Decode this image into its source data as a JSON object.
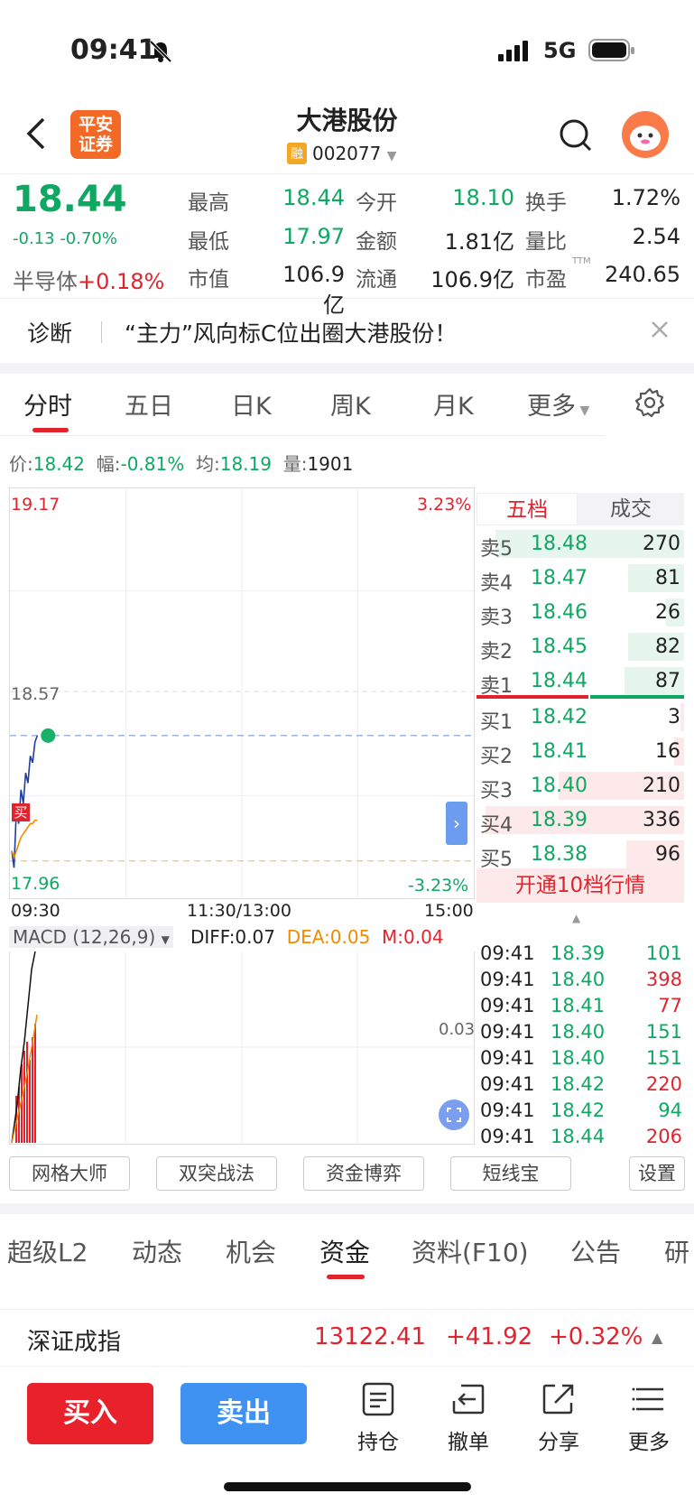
{
  "status": {
    "time": "09:41",
    "network": "5G"
  },
  "header": {
    "logo_line1": "平安",
    "logo_line2": "证券",
    "stock_name": "大港股份",
    "margin_badge": "融",
    "stock_code": "002077"
  },
  "quote": {
    "price": "18.44",
    "change": "-0.13",
    "change_pct": "-0.70%",
    "sector_name": "半导体",
    "sector_change": "+0.18%",
    "fields": [
      {
        "label": "最高",
        "value": "18.44",
        "color": "#0fa863"
      },
      {
        "label": "今开",
        "value": "18.10",
        "color": "#0fa863"
      },
      {
        "label": "换手",
        "value": "1.72%",
        "color": "#222222"
      },
      {
        "label": "最低",
        "value": "17.97",
        "color": "#0fa863"
      },
      {
        "label": "金额",
        "value": "1.81亿",
        "color": "#222222"
      },
      {
        "label": "量比",
        "value": "2.54",
        "color": "#222222"
      },
      {
        "label": "市值",
        "value": "106.9亿",
        "color": "#222222"
      },
      {
        "label": "流通",
        "value": "106.9亿",
        "color": "#222222"
      },
      {
        "label": "市盈",
        "value": "240.65",
        "color": "#222222",
        "sup": "TTM"
      }
    ]
  },
  "diagnosis": {
    "label": "诊断",
    "text": "“主力”风向标C位出圈大港股份！"
  },
  "chart_tabs": [
    "分时",
    "五日",
    "日K",
    "周K",
    "月K",
    "更多"
  ],
  "info_line": {
    "price_label": "价:",
    "price": "18.42",
    "range_label": "幅:",
    "range": "-0.81%",
    "avg_label": "均:",
    "avg": "18.19",
    "vol_label": "量:",
    "vol": "1901"
  },
  "chart": {
    "price_max": "19.17",
    "price_mid": "18.57",
    "price_min": "17.96",
    "pct_max": "3.23%",
    "pct_min": "-3.23%",
    "time_start": "09:30",
    "time_mid": "11:30/13:00",
    "time_end": "15:00",
    "buy_marker": "买",
    "macd_title": "MACD (12,26,9)",
    "diff": "DIFF:0.07",
    "dea": "DEA:0.05",
    "m": "M:0.04",
    "macd_level": "0.03"
  },
  "chart_data": {
    "type": "line",
    "title": "",
    "x": [
      "09:30",
      "09:31",
      "09:32",
      "09:33",
      "09:34",
      "09:35",
      "09:36",
      "09:37",
      "09:38",
      "09:39",
      "09:40",
      "09:41"
    ],
    "series": [
      {
        "name": "价",
        "values": [
          18.1,
          18.05,
          18.22,
          18.18,
          18.28,
          18.24,
          18.33,
          18.3,
          18.38,
          18.36,
          18.42,
          18.44
        ]
      },
      {
        "name": "均",
        "values": [
          18.1,
          18.08,
          18.1,
          18.12,
          18.14,
          18.15,
          18.16,
          18.17,
          18.18,
          18.18,
          18.19,
          18.19
        ]
      }
    ],
    "ylim": [
      17.96,
      19.17
    ],
    "prev_close": 18.57,
    "grid": true
  },
  "orderbook": {
    "tab_active": "五档",
    "tab_other": "成交",
    "asks": [
      {
        "label": "卖5",
        "price": "18.48",
        "vol": "270",
        "depth": 0.95
      },
      {
        "label": "卖4",
        "price": "18.47",
        "vol": "81",
        "depth": 0.28
      },
      {
        "label": "卖3",
        "price": "18.46",
        "vol": "26",
        "depth": 0.09
      },
      {
        "label": "卖2",
        "price": "18.45",
        "vol": "82",
        "depth": 0.28
      },
      {
        "label": "卖1",
        "price": "18.44",
        "vol": "87",
        "depth": 0.3
      }
    ],
    "bids": [
      {
        "label": "买1",
        "price": "18.42",
        "vol": "3",
        "depth": 0.01
      },
      {
        "label": "买2",
        "price": "18.41",
        "vol": "16",
        "depth": 0.05
      },
      {
        "label": "买3",
        "price": "18.40",
        "vol": "210",
        "depth": 0.63
      },
      {
        "label": "买4",
        "price": "18.39",
        "vol": "336",
        "depth": 1.0
      },
      {
        "label": "买5",
        "price": "18.38",
        "vol": "96",
        "depth": 0.29
      }
    ],
    "upgrade": "开通10档行情"
  },
  "ticks": [
    {
      "time": "09:41",
      "price": "18.39",
      "vol": "101",
      "pc": "#0fa863",
      "vc": "#0fa863"
    },
    {
      "time": "09:41",
      "price": "18.40",
      "vol": "398",
      "pc": "#0fa863",
      "vc": "#e0242e"
    },
    {
      "time": "09:41",
      "price": "18.41",
      "vol": "77",
      "pc": "#0fa863",
      "vc": "#e0242e"
    },
    {
      "time": "09:41",
      "price": "18.40",
      "vol": "151",
      "pc": "#0fa863",
      "vc": "#0fa863"
    },
    {
      "time": "09:41",
      "price": "18.40",
      "vol": "151",
      "pc": "#0fa863",
      "vc": "#0fa863"
    },
    {
      "time": "09:41",
      "price": "18.42",
      "vol": "220",
      "pc": "#0fa863",
      "vc": "#e0242e"
    },
    {
      "time": "09:41",
      "price": "18.42",
      "vol": "94",
      "pc": "#0fa863",
      "vc": "#0fa863"
    },
    {
      "time": "09:41",
      "price": "18.44",
      "vol": "206",
      "pc": "#0fa863",
      "vc": "#e0242e"
    }
  ],
  "tools": [
    "网格大师",
    "双突战法",
    "资金博弈",
    "短线宝",
    "设置"
  ],
  "info_tabs": [
    "超级L2",
    "动态",
    "机会",
    "资金",
    "资料(F10)",
    "公告",
    "研"
  ],
  "index": {
    "name": "深证成指",
    "value": "13122.41",
    "change": "+41.92",
    "pct": "+0.32%"
  },
  "actions": {
    "buy": "买入",
    "sell": "卖出",
    "hold": "持仓",
    "cancel": "撤单",
    "share": "分享",
    "more": "更多"
  }
}
